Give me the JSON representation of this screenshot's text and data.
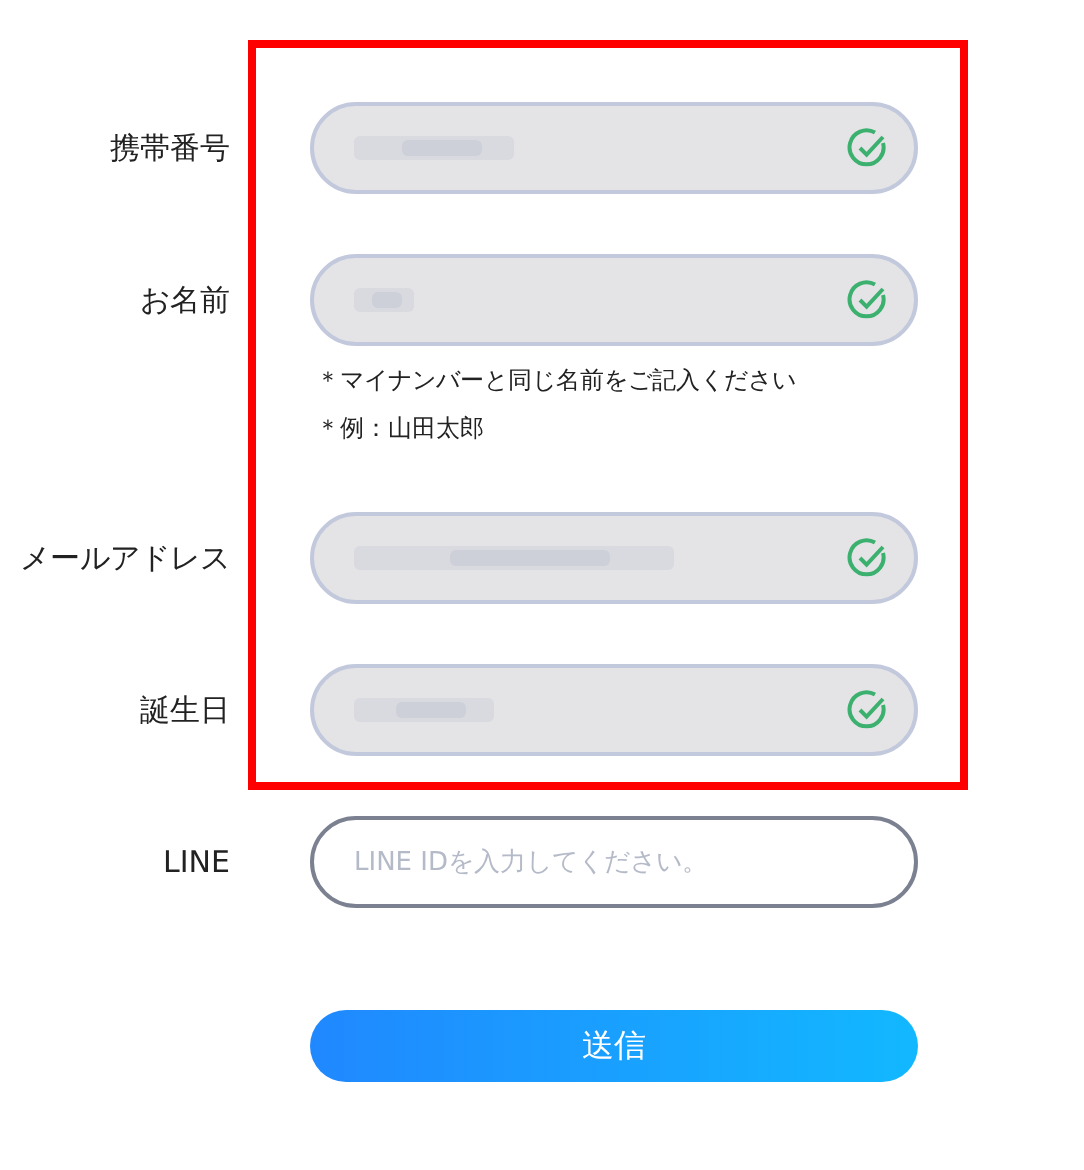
{
  "fields": [
    {
      "label": "携帯番号",
      "masked": true,
      "verified": true,
      "highlighted": true
    },
    {
      "label": "お名前",
      "masked": true,
      "verified": true,
      "highlighted": true,
      "notes": [
        "＊マイナンバーと同じ名前をご記入ください",
        "＊例：山田太郎"
      ]
    },
    {
      "label": "メールアドレス",
      "masked": true,
      "verified": true,
      "highlighted": true
    },
    {
      "label": "誕生日",
      "masked": true,
      "verified": true,
      "highlighted": true
    },
    {
      "label": "LINE",
      "placeholder": "LINE IDを入力してください。",
      "masked": false,
      "verified": false,
      "highlighted": false
    }
  ],
  "submit": {
    "label": "送信"
  }
}
